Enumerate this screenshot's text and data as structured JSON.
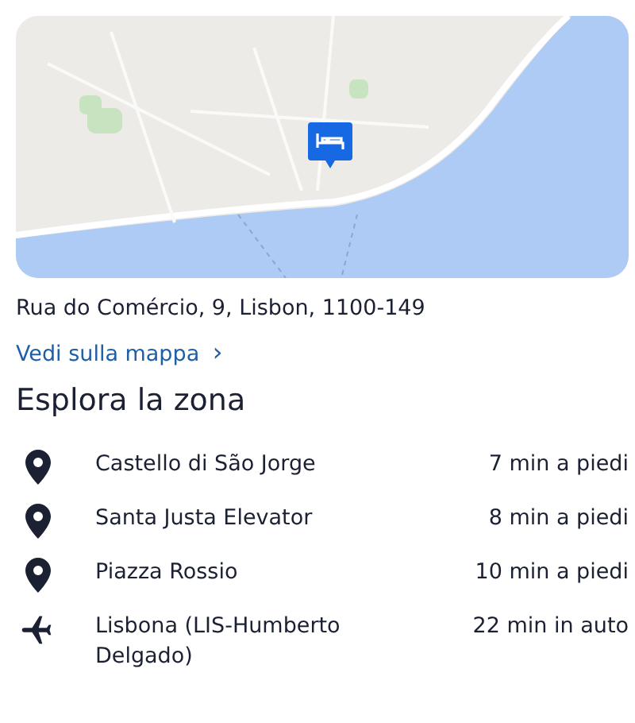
{
  "address": "Rua do Comércio, 9, Lisbon, 1100-149",
  "map_link": {
    "label": "Vedi sulla mappa",
    "chevron": "›"
  },
  "section_title": "Esplora la zona",
  "places": [
    {
      "kind": "landmark",
      "name": "Castello di São Jorge",
      "distance": "7 min a piedi"
    },
    {
      "kind": "landmark",
      "name": "Santa Justa Elevator",
      "distance": "8 min a piedi"
    },
    {
      "kind": "landmark",
      "name": "Piazza Rossio",
      "distance": "10 min a piedi"
    },
    {
      "kind": "airport",
      "name": "Lisbona (LIS-Humberto Delgado)",
      "distance": "22 min in auto"
    }
  ]
}
